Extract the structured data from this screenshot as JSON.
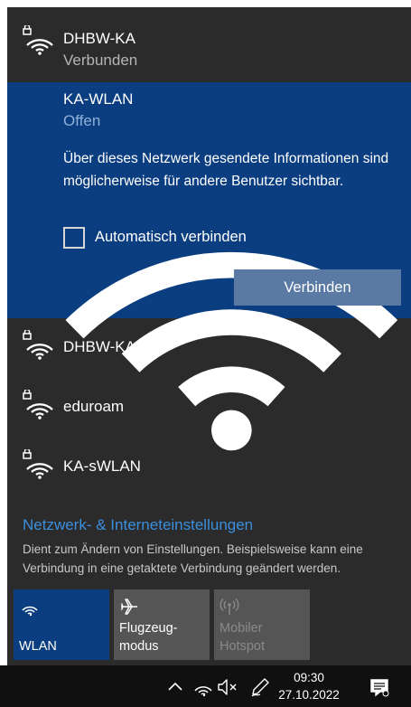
{
  "networks": {
    "connected": {
      "name": "DHBW-KA",
      "status": "Verbunden",
      "icon": "wifi-secured-icon"
    },
    "selected": {
      "name": "KA-WLAN",
      "status": "Offen",
      "icon": "wifi-open-icon",
      "info": "Über dieses Netzwerk gesendete Informationen sind möglicherweise für andere Benutzer sichtbar.",
      "auto_connect_label": "Automatisch verbinden",
      "auto_connect_checked": false,
      "connect_label": "Verbinden"
    },
    "others": [
      {
        "name": "DHBW-KA5",
        "icon": "wifi-secured-icon"
      },
      {
        "name": "eduroam",
        "icon": "wifi-secured-icon"
      },
      {
        "name": "KA-sWLAN",
        "icon": "wifi-secured-icon"
      }
    ]
  },
  "settings": {
    "link": "Netzwerk- & Interneteinstellungen",
    "description": "Dient zum Ändern von Einstellungen. Beispielsweise kann eine Verbindung in eine getaktete Verbindung geändert werden."
  },
  "quick_actions": [
    {
      "label": "WLAN",
      "state": "on",
      "icon": "wifi-icon"
    },
    {
      "label": "Flugzeug-\nmodus",
      "state": "off",
      "icon": "airplane-icon"
    },
    {
      "label": "Mobiler\nHotspot",
      "state": "disabled",
      "icon": "hotspot-icon"
    }
  ],
  "taskbar": {
    "time": "09:30",
    "date": "27.10.2022",
    "icons": [
      "chevron-up-icon",
      "wifi-icon",
      "speaker-muted-icon",
      "pen-icon",
      "notification-icon"
    ]
  },
  "colors": {
    "flyout_bg": "#2b2b2b",
    "selected_bg": "#0b3e80",
    "link": "#3a8fde",
    "button": "#5a7aa3",
    "tile": "#555555",
    "taskbar": "#101010"
  }
}
